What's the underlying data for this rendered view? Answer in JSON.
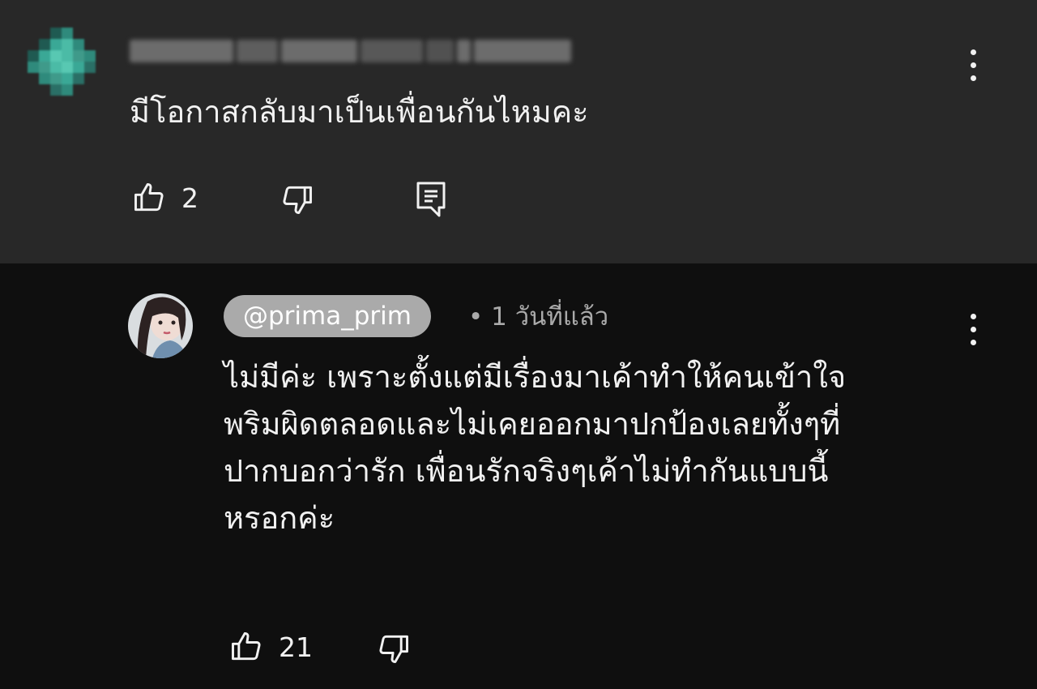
{
  "parent_comment": {
    "text": "มีโอกาสกลับมาเป็นเพื่อนกันไหมคะ",
    "likes": "2",
    "icons": {
      "like": "thumbs-up-icon",
      "dislike": "thumbs-down-icon",
      "reply": "reply-comment-icon",
      "menu": "more-vert-icon"
    }
  },
  "reply": {
    "author": "@prima_prim",
    "time": "• 1 วันที่แล้ว",
    "lines": [
      "ไม่มีค่ะ เพราะตั้งแต่มีเรื่องมาเค้าทำให้คนเข้าใจ",
      "พริมผิดตลอดและไม่เคยออกมาปกป้องเลยทั้งๆที่",
      "ปากบอกว่ารัก เพื่อนรักจริงๆเค้าไม่ทำกันแบบนี้",
      "หรอกค่ะ"
    ],
    "likes": "21",
    "icons": {
      "like": "thumbs-up-icon",
      "dislike": "thumbs-down-icon",
      "menu": "more-vert-icon"
    }
  },
  "colors": {
    "parent_bg": "#282828",
    "reply_bg": "#0f0f0f",
    "handle_chip": "#aaaaaa",
    "text": "#f1f1f1",
    "meta": "#aaaaaa"
  }
}
